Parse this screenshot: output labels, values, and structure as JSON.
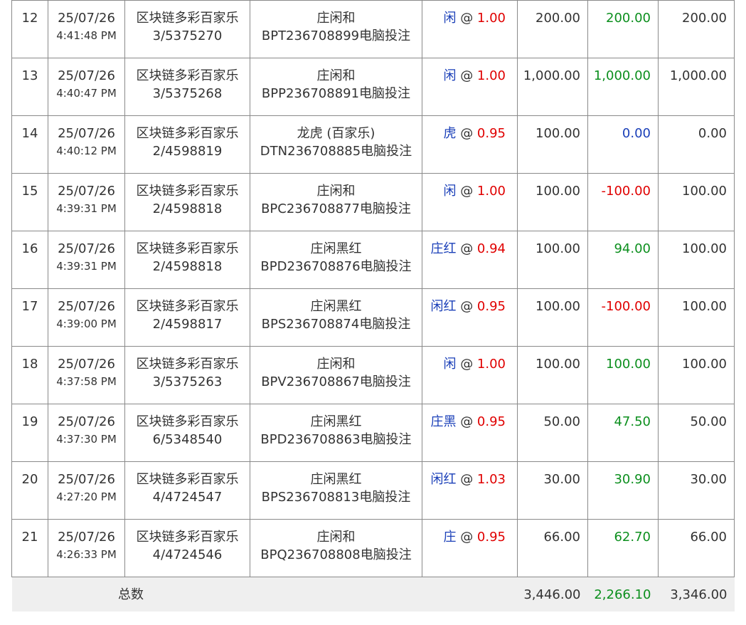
{
  "colors": {
    "selection_blue": "#1a3fb8",
    "odds_red": "#e00000",
    "win_green": "#0c8f1e",
    "footer_bg": "#efefef"
  },
  "rows": [
    {
      "no": "12",
      "date": "25/07/26",
      "time": "4:41:48 PM",
      "game": "区块链多彩百家乐",
      "round": "3/5375270",
      "bet_type": "庄闲和",
      "ticket": "BPT236708899电脑投注",
      "selection": "闲",
      "odds": "1.00",
      "stake": "200.00",
      "win": "200.00",
      "win_color": "green",
      "valid": "200.00"
    },
    {
      "no": "13",
      "date": "25/07/26",
      "time": "4:40:47 PM",
      "game": "区块链多彩百家乐",
      "round": "3/5375268",
      "bet_type": "庄闲和",
      "ticket": "BPP236708891电脑投注",
      "selection": "闲",
      "odds": "1.00",
      "stake": "1,000.00",
      "win": "1,000.00",
      "win_color": "green",
      "valid": "1,000.00"
    },
    {
      "no": "14",
      "date": "25/07/26",
      "time": "4:40:12 PM",
      "game": "区块链多彩百家乐",
      "round": "2/4598819",
      "bet_type": "龙虎 (百家乐)",
      "ticket": "DTN236708885电脑投注",
      "selection": "虎",
      "odds": "0.95",
      "stake": "100.00",
      "win": "0.00",
      "win_color": "blue",
      "valid": "0.00"
    },
    {
      "no": "15",
      "date": "25/07/26",
      "time": "4:39:31 PM",
      "game": "区块链多彩百家乐",
      "round": "2/4598818",
      "bet_type": "庄闲和",
      "ticket": "BPC236708877电脑投注",
      "selection": "闲",
      "odds": "1.00",
      "stake": "100.00",
      "win": "-100.00",
      "win_color": "red",
      "valid": "100.00"
    },
    {
      "no": "16",
      "date": "25/07/26",
      "time": "4:39:31 PM",
      "game": "区块链多彩百家乐",
      "round": "2/4598818",
      "bet_type": "庄闲黑红",
      "ticket": "BPD236708876电脑投注",
      "selection": "庄红",
      "odds": "0.94",
      "stake": "100.00",
      "win": "94.00",
      "win_color": "green",
      "valid": "100.00"
    },
    {
      "no": "17",
      "date": "25/07/26",
      "time": "4:39:00 PM",
      "game": "区块链多彩百家乐",
      "round": "2/4598817",
      "bet_type": "庄闲黑红",
      "ticket": "BPS236708874电脑投注",
      "selection": "闲红",
      "odds": "0.95",
      "stake": "100.00",
      "win": "-100.00",
      "win_color": "red",
      "valid": "100.00"
    },
    {
      "no": "18",
      "date": "25/07/26",
      "time": "4:37:58 PM",
      "game": "区块链多彩百家乐",
      "round": "3/5375263",
      "bet_type": "庄闲和",
      "ticket": "BPV236708867电脑投注",
      "selection": "闲",
      "odds": "1.00",
      "stake": "100.00",
      "win": "100.00",
      "win_color": "green",
      "valid": "100.00"
    },
    {
      "no": "19",
      "date": "25/07/26",
      "time": "4:37:30 PM",
      "game": "区块链多彩百家乐",
      "round": "6/5348540",
      "bet_type": "庄闲黑红",
      "ticket": "BPD236708863电脑投注",
      "selection": "庄黑",
      "odds": "0.95",
      "stake": "50.00",
      "win": "47.50",
      "win_color": "green",
      "valid": "50.00"
    },
    {
      "no": "20",
      "date": "25/07/26",
      "time": "4:27:20 PM",
      "game": "区块链多彩百家乐",
      "round": "4/4724547",
      "bet_type": "庄闲黑红",
      "ticket": "BPS236708813电脑投注",
      "selection": "闲红",
      "odds": "1.03",
      "stake": "30.00",
      "win": "30.90",
      "win_color": "green",
      "valid": "30.00"
    },
    {
      "no": "21",
      "date": "25/07/26",
      "time": "4:26:33 PM",
      "game": "区块链多彩百家乐",
      "round": "4/4724546",
      "bet_type": "庄闲和",
      "ticket": "BPQ236708808电脑投注",
      "selection": "庄",
      "odds": "0.95",
      "stake": "66.00",
      "win": "62.70",
      "win_color": "green",
      "valid": "66.00"
    }
  ],
  "totals": {
    "label": "总数",
    "stake": "3,446.00",
    "win": "2,266.10",
    "valid": "3,346.00"
  }
}
